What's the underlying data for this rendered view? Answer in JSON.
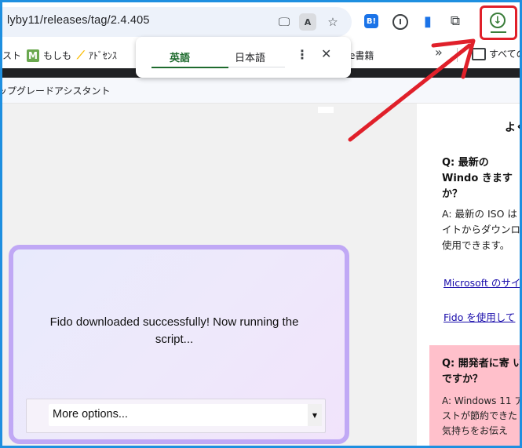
{
  "browser": {
    "url": "lyby11/releases/tag/2.4.405",
    "translate_badge": "A",
    "extension_b": "B!",
    "extension_circle": "I"
  },
  "bookmarks": {
    "item0": "スト",
    "item1": "もしも",
    "item1_icon": "M",
    "item2": "ｱﾄﾞｾﾝｽ",
    "item3": "e書籍",
    "all": "すべての"
  },
  "translate_popup": {
    "tab_source": "英語",
    "tab_target": "日本語"
  },
  "page": {
    "bar_text": "ップグレードアシスタント"
  },
  "card": {
    "message": "Fido downloaded successfully! Now running the script...",
    "select_value": "More options..."
  },
  "sidebar": {
    "heading": "よく",
    "q1": "Q: 最新の Windo きますか？",
    "a1_line1": "A: 最新の ISO は",
    "a1_line2": "イトからダウンロー",
    "a1_line3": "使用できます。",
    "link1": "Microsoft のサイ",
    "link2": "Fido を使用して",
    "q2": "Q: 開発者に寄 いですか？",
    "a2_line1": "A: Windows 11 ア",
    "a2_line2": "ストが節約できた",
    "a2_line3": "気持ちをお伝え"
  },
  "colors": {
    "frame_border": "#1e8fe0",
    "highlight_red": "#e0202a",
    "card_border": "#c0a8f5",
    "faq_pink": "#ffc0cb",
    "translate_active": "#1e6b2e"
  },
  "icons": [
    "install-app-icon",
    "translate-icon",
    "bookmark-star-icon",
    "hatena-bookmark-icon",
    "extension-circle-icon",
    "chat-icon",
    "extensions-puzzle-icon",
    "download-icon",
    "more-vert-icon",
    "close-icon",
    "chevron-double-right-icon",
    "folder-icon",
    "dropdown-arrow-icon"
  ]
}
